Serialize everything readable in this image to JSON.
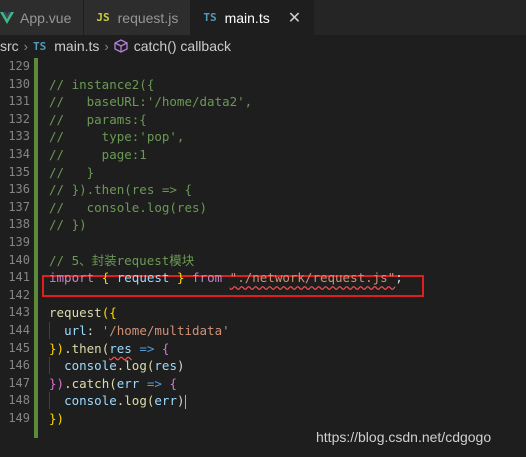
{
  "tabs": [
    {
      "label": "App.vue",
      "icon": "vue-icon"
    },
    {
      "label": "request.js",
      "icon_text": "JS"
    },
    {
      "label": "main.ts",
      "icon_text": "TS",
      "active": true
    }
  ],
  "breadcrumb": {
    "folder": "src",
    "file_icon_text": "TS",
    "file": "main.ts",
    "symbol": "catch() callback"
  },
  "editor": {
    "line_numbers": [
      "129",
      "130",
      "131",
      "132",
      "133",
      "134",
      "135",
      "136",
      "137",
      "138",
      "139",
      "140",
      "141",
      "142",
      "143",
      "144",
      "145",
      "146",
      "147",
      "148",
      "149"
    ],
    "lines": {
      "l130": "// instance2({",
      "l131": "//   baseURL:'/home/data2',",
      "l132": "//   params:{",
      "l133": "//     type:'pop',",
      "l134": "//     page:1",
      "l135": "//   }",
      "l136": "// }).then(res => {",
      "l137": "//   console.log(res)",
      "l138": "// })",
      "l140": "// 5、封装request模块",
      "l141_import": "import",
      "l141_brace_open": "{",
      "l141_name": "request",
      "l141_brace_close": "}",
      "l141_from": "from",
      "l141_path": "\"./network/request.js\"",
      "l141_semi": ";",
      "l143_fn": "request",
      "l143_open": "({",
      "l144_key": "url",
      "l144_colon": ":",
      "l144_val": "'/home/multidata'",
      "l145_close": "})",
      "l145_then": ".then(",
      "l145_param": "res",
      "l145_arrow": "=>",
      "l145_brace": "{",
      "l146_console": "console",
      "l146_log": ".log(",
      "l146_arg": "res",
      "l146_close": ")",
      "l147_close": "})",
      "l147_catch": ".catch(",
      "l147_param": "err",
      "l147_arrow": "=>",
      "l147_brace": "{",
      "l148_console": "console",
      "l148_log": ".log(",
      "l148_arg": "err",
      "l148_close": ")",
      "l149_close": "})"
    }
  },
  "watermark": "https://blog.csdn.net/cdgogo",
  "colors": {
    "comment": "#6a9955",
    "keyword": "#c586c0",
    "string": "#ce9178",
    "function": "#dcdcaa",
    "variable": "#9cdcfe",
    "highlight_box": "#e01e1e"
  }
}
